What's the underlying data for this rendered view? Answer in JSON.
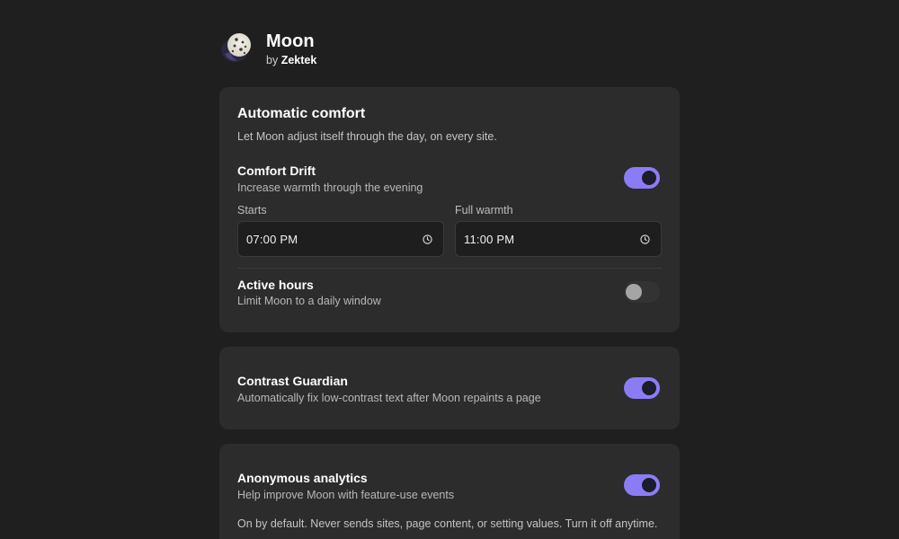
{
  "app": {
    "name": "Moon",
    "by_prefix": "by",
    "author": "Zektek",
    "logo_icon": "moon-logo-icon"
  },
  "colors": {
    "background": "#1f1f1f",
    "card": "#2c2c2c",
    "accent": "#8b7cf6",
    "toggle_off": "#333333"
  },
  "automatic_comfort": {
    "title": "Automatic comfort",
    "description": "Let Moon adjust itself through the day, on every site.",
    "comfort_drift": {
      "title": "Comfort Drift",
      "subtitle": "Increase warmth through the evening",
      "enabled": true,
      "starts_label": "Starts",
      "starts_value": "07:00  PM",
      "full_warmth_label": "Full warmth",
      "full_warmth_value": "11:00  PM",
      "clock_icon": "clock-icon"
    },
    "active_hours": {
      "title": "Active hours",
      "subtitle": "Limit Moon to a daily window",
      "enabled": false
    }
  },
  "contrast_guardian": {
    "title": "Contrast Guardian",
    "subtitle": "Automatically fix low-contrast text after Moon repaints a page",
    "enabled": true
  },
  "analytics": {
    "title": "Anonymous analytics",
    "subtitle": "Help improve Moon with feature-use events",
    "enabled": true,
    "note": "On by default. Never sends sites, page content, or setting values. Turn it off anytime."
  }
}
